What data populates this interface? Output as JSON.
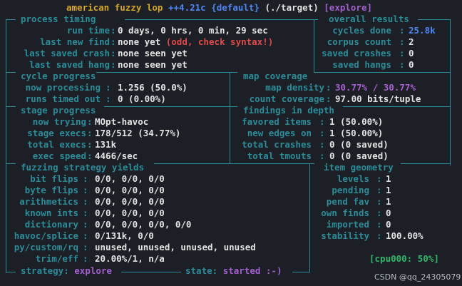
{
  "title": {
    "app": "american fuzzy lop",
    "version": "++4.21c",
    "profile": "{default}",
    "target": "(./target)",
    "mode": "[explore]"
  },
  "sections": {
    "process_timing": "process timing",
    "overall_results": "overall results",
    "cycle_progress": "cycle progress",
    "map_coverage": "map coverage",
    "stage_progress": "stage progress",
    "findings_in_depth": "findings in depth",
    "fuzzing_strategy_yields": "fuzzing strategy yields",
    "item_geometry": "item geometry"
  },
  "process_timing": [
    {
      "label": "run time",
      "value": "0 days, 0 hrs, 0 min, 29 sec"
    },
    {
      "label": "last new find",
      "value": "none yet",
      "note": "(odd, check syntax!)"
    },
    {
      "label": "last saved crash",
      "value": "none seen yet"
    },
    {
      "label": "last saved hang",
      "value": "none seen yet"
    }
  ],
  "overall_results": [
    {
      "label": "cycles done",
      "value": "25.8k"
    },
    {
      "label": "corpus count",
      "value": "2"
    },
    {
      "label": "saved crashes",
      "value": "0"
    },
    {
      "label": "saved hangs",
      "value": "0"
    }
  ],
  "cycle_progress": [
    {
      "label": "now processing",
      "value": "1.256 (50.0%)"
    },
    {
      "label": "runs timed out",
      "value": "0 (0.00%)"
    }
  ],
  "map_coverage": [
    {
      "label": "map density",
      "value": "30.77% / 30.77%"
    },
    {
      "label": "count coverage",
      "value": "97.00 bits/tuple"
    }
  ],
  "stage_progress": [
    {
      "label": "now trying",
      "value": "MOpt-havoc"
    },
    {
      "label": "stage execs",
      "value": "178/512 (34.77%)"
    },
    {
      "label": "total execs",
      "value": "131k"
    },
    {
      "label": "exec speed",
      "value": "4466/sec"
    }
  ],
  "findings_in_depth": [
    {
      "label": "favored items",
      "value": "1 (50.00%)"
    },
    {
      "label": "new edges on",
      "value": "1 (50.00%)"
    },
    {
      "label": "total crashes",
      "value": "0 (0 saved)"
    },
    {
      "label": "total tmouts",
      "value": "0 (0 saved)"
    }
  ],
  "fuzzing_strategy_yields": [
    {
      "label": "bit flips",
      "value": "0/0, 0/0, 0/0"
    },
    {
      "label": "byte flips",
      "value": "0/0, 0/0, 0/0"
    },
    {
      "label": "arithmetics",
      "value": "0/0, 0/0, 0/0"
    },
    {
      "label": "known ints",
      "value": "0/0, 0/0, 0/0"
    },
    {
      "label": "dictionary",
      "value": "0/0, 0/0, 0/0, 0/0"
    },
    {
      "label": "havoc/splice",
      "value": "0/131k, 0/0"
    },
    {
      "label": "py/custom/rq",
      "value": "unused, unused, unused, unused"
    },
    {
      "label": "trim/eff",
      "value": "20.00%/1, n/a"
    }
  ],
  "item_geometry": [
    {
      "label": "levels",
      "value": "1"
    },
    {
      "label": "pending",
      "value": "1"
    },
    {
      "label": "pend fav",
      "value": "1"
    },
    {
      "label": "own finds",
      "value": "0"
    },
    {
      "label": "imported",
      "value": "0"
    },
    {
      "label": "stability",
      "value": "100.00%"
    }
  ],
  "cpu": {
    "label": "cpu000:",
    "value": "50%"
  },
  "footer": {
    "strategy_label": "strategy:",
    "strategy": "explore",
    "state_label": "state:",
    "state": "started :-)"
  },
  "watermark": "CSDN @qq_24305079",
  "colors": {
    "border": "#2c8c99",
    "title": "#d6a52b",
    "highlight": "#4f86f0",
    "accent": "#a45fd0",
    "warning": "#e24a4a",
    "cpu": "#35b56a"
  }
}
